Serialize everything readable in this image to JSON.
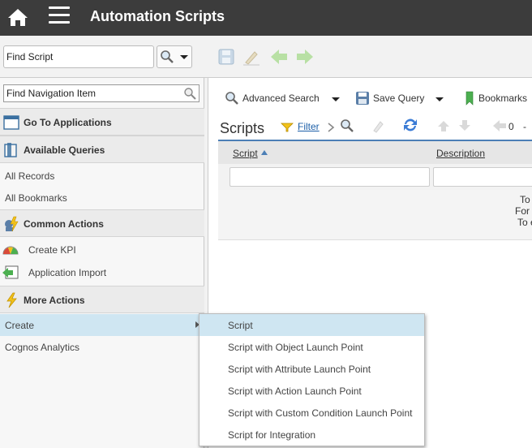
{
  "app": {
    "title": "Automation Scripts"
  },
  "toolbar": {
    "find_script_value": "Find Script"
  },
  "nav": {
    "search_value": "Find Navigation Item",
    "go_to_applications": "Go To Applications",
    "available_queries": "Available Queries",
    "all_records": "All Records",
    "all_bookmarks": "All Bookmarks",
    "common_actions": "Common Actions",
    "create_kpi": "Create KPI",
    "application_import": "Application Import",
    "more_actions": "More Actions",
    "create": "Create",
    "cognos_analytics": "Cognos Analytics"
  },
  "main": {
    "advanced_search": "Advanced Search",
    "save_query": "Save Query",
    "bookmarks": "Bookmarks",
    "list_title": "Scripts",
    "filter_label": "Filter",
    "record_count": "0",
    "record_dash": "-",
    "columns": {
      "script": "Script",
      "description": "Description"
    },
    "message_lines": [
      "To",
      "For r",
      "To e"
    ]
  },
  "submenu": {
    "items": [
      "Script",
      "Script with Object Launch Point",
      "Script with Attribute Launch Point",
      "Script with Action Launch Point",
      "Script with Custom Condition Launch Point",
      "Script for Integration"
    ]
  },
  "colors": {
    "titlebar": "#3c3c3c",
    "highlight": "#cfe6f2",
    "link": "#1c5fa8",
    "accent_line": "#4c7fb6"
  }
}
